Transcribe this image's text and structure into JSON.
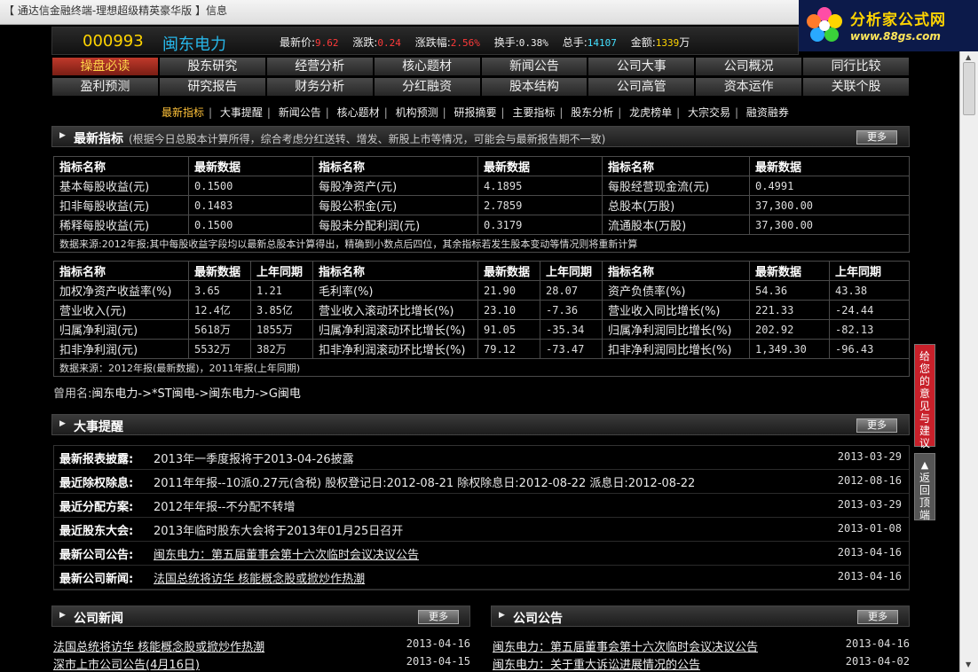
{
  "window": {
    "title": "【 通达信金融终端-理想超级精英豪华版 】信息"
  },
  "logo": {
    "brand": "分析家公式网",
    "url": "www.88gs.com"
  },
  "quote": {
    "code": "000993",
    "name": "闽东电力",
    "latest_price_label": "最新价:",
    "latest_price": "9.62",
    "change_label": "涨跌:",
    "change": "0.24",
    "change_pct_label": "涨跌幅:",
    "change_pct": "2.56%",
    "turnover_label": "换手:",
    "turnover": "0.38%",
    "volume_label": "总手:",
    "volume": "14107",
    "amount_label": "金额:",
    "amount": "1339",
    "amount_unit": "万"
  },
  "nav": {
    "row1": [
      "操盘必读",
      "股东研究",
      "经营分析",
      "核心题材",
      "新闻公告",
      "公司大事",
      "公司概况",
      "同行比较"
    ],
    "row2": [
      "盈利预测",
      "研究报告",
      "财务分析",
      "分红融资",
      "股本结构",
      "公司高管",
      "资本运作",
      "关联个股"
    ]
  },
  "sublinks": [
    "最新指标",
    "大事提醒",
    "新闻公告",
    "核心题材",
    "机构预测",
    "研报摘要",
    "主要指标",
    "股东分析",
    "龙虎榜单",
    "大宗交易",
    "融资融券"
  ],
  "sections": {
    "latest": {
      "title": "最新指标",
      "subtitle": "(根据今日总股本计算所得，综合考虑分红送转、增发、新股上市等情况，可能会与最新报告期不一致)",
      "more": "更多"
    },
    "events": {
      "title": "大事提醒",
      "more": "更多"
    },
    "news": {
      "title": "公司新闻",
      "more": "更多"
    },
    "notices": {
      "title": "公司公告",
      "more": "更多"
    }
  },
  "table1": {
    "headers": [
      "指标名称",
      "最新数据",
      "指标名称",
      "最新数据",
      "指标名称",
      "最新数据"
    ],
    "rows": [
      [
        "基本每股收益(元)",
        "0.1500",
        "每股净资产(元)",
        "4.1895",
        "每股经营现金流(元)",
        "0.4991"
      ],
      [
        "扣非每股收益(元)",
        "0.1483",
        "每股公积金(元)",
        "2.7859",
        "总股本(万股)",
        "37,300.00"
      ],
      [
        "稀释每股收益(元)",
        "0.1500",
        "每股未分配利润(元)",
        "0.3179",
        "流通股本(万股)",
        "37,300.00"
      ]
    ],
    "note": "数据来源:2012年报;其中每股收益字段均以最新总股本计算得出，精确到小数点后四位，其余指标若发生股本变动等情况则将重新计算"
  },
  "table2": {
    "headers": [
      "指标名称",
      "最新数据",
      "上年同期",
      "指标名称",
      "最新数据",
      "上年同期",
      "指标名称",
      "最新数据",
      "上年同期"
    ],
    "rows": [
      [
        "加权净资产收益率(%)",
        "3.65",
        "1.21",
        "毛利率(%)",
        "21.90",
        "28.07",
        "资产负债率(%)",
        "54.36",
        "43.38"
      ],
      [
        "营业收入(元)",
        "12.4亿",
        "3.85亿",
        "营业收入滚动环比增长(%)",
        "23.10",
        "-7.36",
        "营业收入同比增长(%)",
        "221.33",
        "-24.44"
      ],
      [
        "归属净利润(元)",
        "5618万",
        "1855万",
        "归属净利润滚动环比增长(%)",
        "91.05",
        "-35.34",
        "归属净利润同比增长(%)",
        "202.92",
        "-82.13"
      ],
      [
        "扣非净利润(元)",
        "5532万",
        "382万",
        "扣非净利润滚动环比增长(%)",
        "79.12",
        "-73.47",
        "扣非净利润同比增长(%)",
        "1,349.30",
        "-96.43"
      ]
    ],
    "note": "数据来源：2012年报(最新数据)，2011年报(上年同期)"
  },
  "used_name": {
    "label": "曾用名:",
    "value": "闽东电力->*ST闽电->闽东电力->G闽电"
  },
  "events": [
    {
      "key": "最新报表披露:",
      "value": "2013年一季度报将于2013-04-26披露",
      "date": "2013-03-29"
    },
    {
      "key": "最近除权除息:",
      "value": "2011年年报--10派0.27元(含税) 股权登记日:2012-08-21 除权除息日:2012-08-22 派息日:2012-08-22",
      "date": "2012-08-16"
    },
    {
      "key": "最近分配方案:",
      "value": "2012年年报--不分配不转增",
      "date": "2013-03-29"
    },
    {
      "key": "最近股东大会:",
      "value": "2013年临时股东大会将于2013年01月25日召开",
      "date": "2013-01-08"
    },
    {
      "key": "最新公司公告:",
      "value": "闽东电力：第五届董事会第十六次临时会议决议公告",
      "date": "2013-04-16"
    },
    {
      "key": "最新公司新闻:",
      "value": "法国总统将访华 核能概念股或掀炒作热潮",
      "date": "2013-04-16"
    }
  ],
  "news": [
    {
      "title": "法国总统将访华 核能概念股或掀炒作热潮",
      "date": "2013-04-16"
    },
    {
      "title": "深市上市公司公告(4月16日)",
      "date": "2013-04-15"
    }
  ],
  "notices": [
    {
      "title": "闽东电力：第五届董事会第十六次临时会议决议公告",
      "date": "2013-04-16"
    },
    {
      "title": "闽东电力：关于重大诉讼进展情况的公告",
      "date": "2013-04-02"
    }
  ],
  "side": {
    "feedback": "给您的意见与建议",
    "back_top": "返回顶端"
  }
}
